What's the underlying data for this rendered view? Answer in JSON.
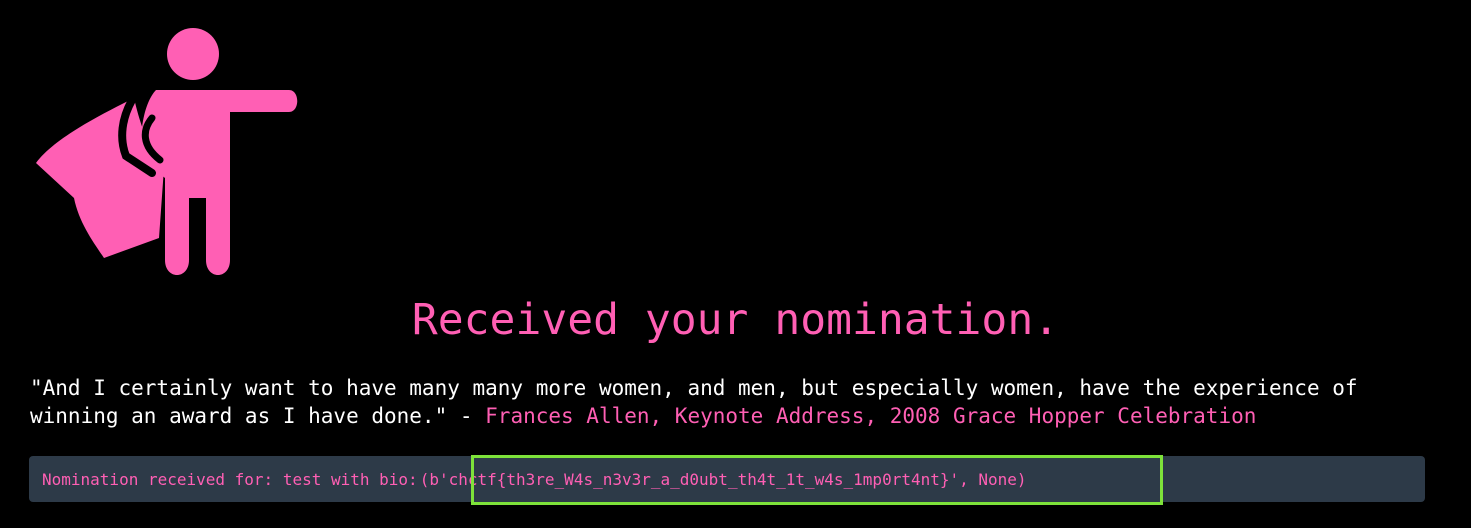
{
  "icon": "superhero-cape-icon",
  "colors": {
    "background": "#000000",
    "accent": "#ff5fb4",
    "text": "#ffffff",
    "panel": "#2d3a48",
    "highlight_border": "#7ee23a"
  },
  "headline": "Received your nomination.",
  "quote": {
    "text": "\"And I certainly want to have many many more women, and men, but especially women, have the experience of winning an award as I have done.\" - ",
    "attribution": "Frances Allen, Keynote Address, 2008 Grace Hopper Celebration"
  },
  "result": {
    "prefix": "Nomination received for: test with bio:",
    "bio": "(b'chctf{th3re_W4s_n3v3r_a_d0ubt_th4t_1t_w4s_1mp0rt4nt}', None)"
  }
}
